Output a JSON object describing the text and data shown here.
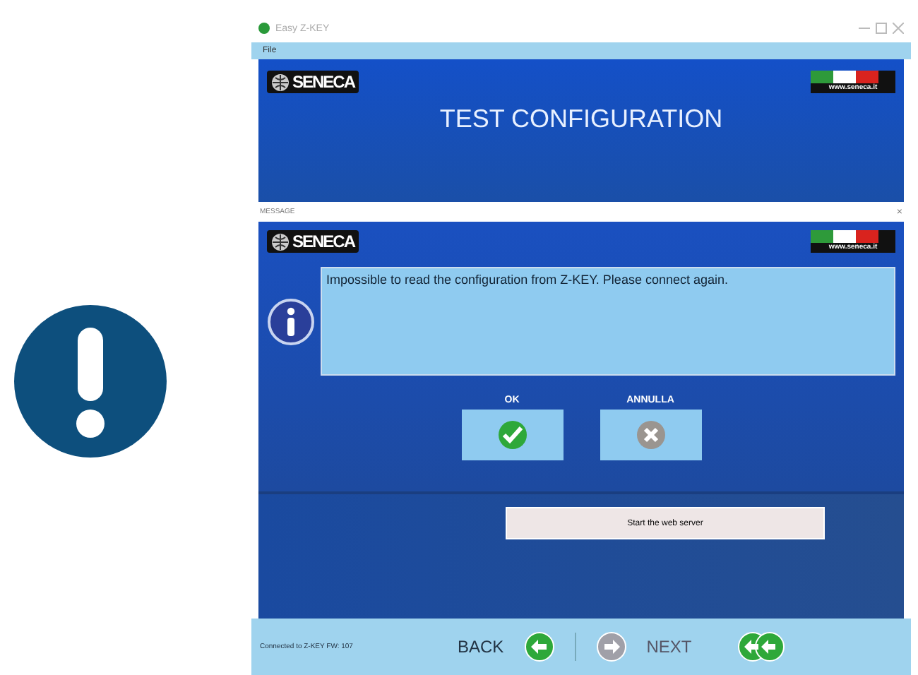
{
  "window": {
    "title": "Easy Z-KEY"
  },
  "menu": [
    "File"
  ],
  "header": {
    "brand": "SENECA",
    "site": "www.seneca.it",
    "title": "TEST CONFIGURATION"
  },
  "message": {
    "title": "MESSAGE",
    "close": "×",
    "brand": "SENECA",
    "site": "www.seneca.it",
    "text": "Impossible to read the configuration from Z-KEY. Please connect again.",
    "buttons": [
      {
        "label": "OK",
        "kind": "ok"
      },
      {
        "label": "ANNULLA",
        "kind": "cancel"
      }
    ]
  },
  "action_button": "Start the web server",
  "status_bar": {
    "text": "Connected to Z-KEY FW: 107",
    "nav": [
      {
        "kind": "back",
        "label": "BACK",
        "disabled": false
      },
      {
        "kind": "next",
        "label": "NEXT",
        "disabled": true
      },
      {
        "kind": "finish",
        "disabled": false
      }
    ]
  }
}
